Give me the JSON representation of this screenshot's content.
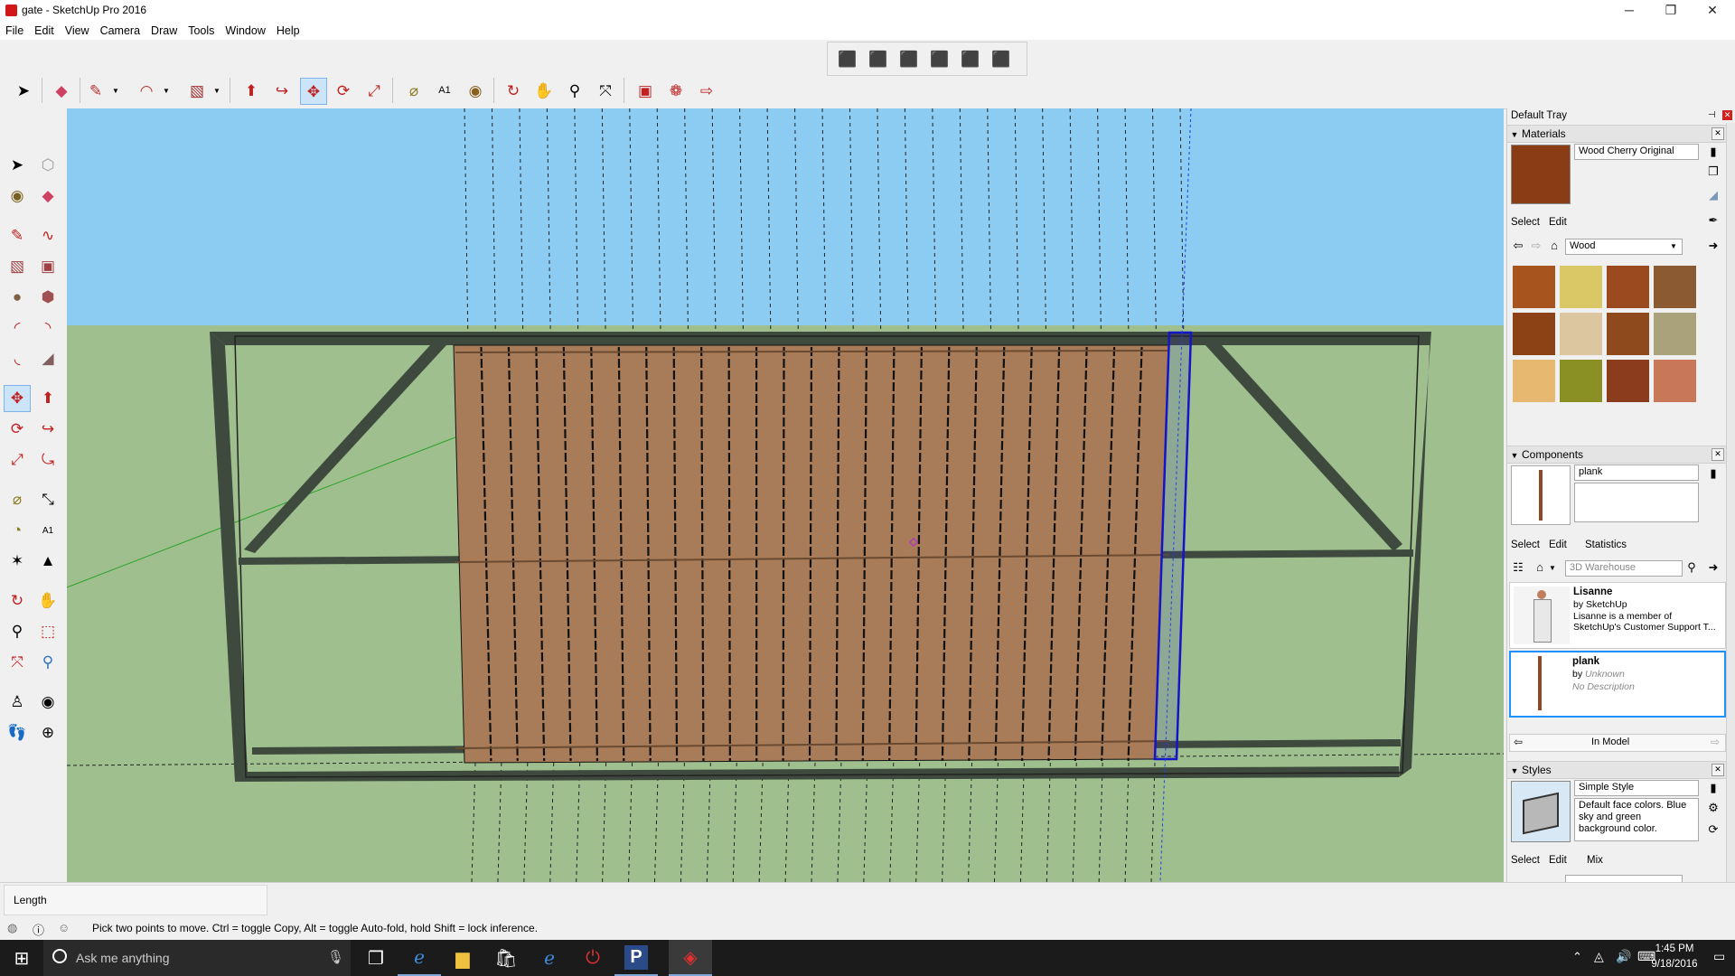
{
  "window": {
    "title": "gate - SketchUp Pro 2016",
    "minimize": "─",
    "maximize": "❐",
    "close": "✕"
  },
  "menu": [
    "File",
    "Edit",
    "View",
    "Camera",
    "Draw",
    "Tools",
    "Window",
    "Help"
  ],
  "tray": {
    "title": "Default Tray",
    "materials": {
      "header": "Materials",
      "current_name": "Wood Cherry Original",
      "tabs": [
        "Select",
        "Edit"
      ],
      "library": "Wood",
      "colors": {
        "current": "#8a3c14",
        "swatches": [
          "#a8541e",
          "#d9c865",
          "#9a4a1e",
          "#8b5a32",
          "#8c4214",
          "#dcc6a0",
          "#8e4a1c",
          "#a9a27a",
          "#e6b870",
          "#8a9024",
          "#8a3c1c",
          "#c87858"
        ]
      }
    },
    "components": {
      "header": "Components",
      "name": "plank",
      "description": "",
      "tabs": [
        "Select",
        "Edit",
        "Statistics"
      ],
      "search_placeholder": "3D Warehouse",
      "items": [
        {
          "title": "Lisanne",
          "by": "by SketchUp",
          "desc": "Lisanne is a member of SketchUp's Customer Support T..."
        },
        {
          "title": "plank",
          "by_prefix": "by",
          "author": "Unknown",
          "desc": "No Description"
        }
      ],
      "nav_label": "In Model"
    },
    "styles": {
      "header": "Styles",
      "name": "Simple Style",
      "description": "Default face colors. Blue sky and green background color.",
      "tabs": [
        "Select",
        "Edit",
        "Mix"
      ]
    }
  },
  "measurements": {
    "label": "Length",
    "value": ""
  },
  "status": {
    "hint": "Pick two points to move.  Ctrl = toggle Copy, Alt = toggle Auto-fold, hold Shift = lock inference."
  },
  "taskbar": {
    "search_placeholder": "Ask me anything",
    "time": "1:45 PM",
    "date": "9/18/2016"
  },
  "scene": {
    "sky": "#8ccbf2",
    "ground": "#9fc08e",
    "frame": "#3f4a3f",
    "plank": "#a87c58",
    "selection": "#1414c8"
  }
}
